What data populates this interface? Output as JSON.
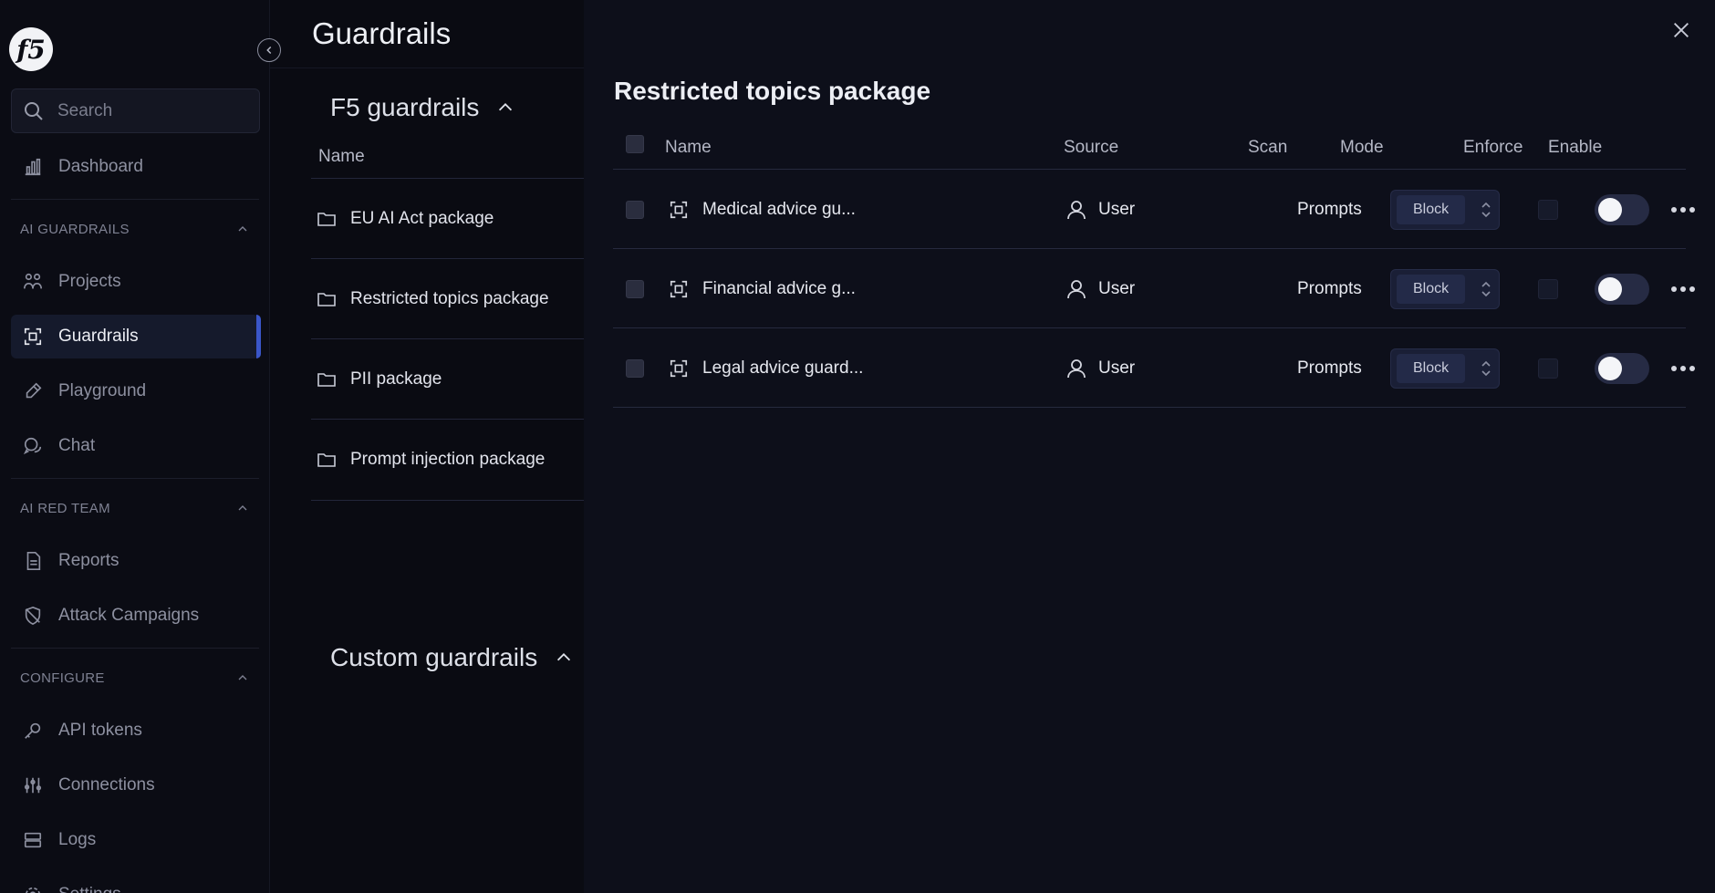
{
  "sidebar": {
    "logo": "f5",
    "search_placeholder": "Search",
    "dashboard": "Dashboard",
    "sections": {
      "ai_guardrails": "AI GUARDRAILS",
      "ai_red_team": "AI RED TEAM",
      "configure": "CONFIGURE"
    },
    "items": {
      "projects": "Projects",
      "guardrails": "Guardrails",
      "playground": "Playground",
      "chat": "Chat",
      "reports": "Reports",
      "attack_campaigns": "Attack Campaigns",
      "api_tokens": "API tokens",
      "connections": "Connections",
      "logs": "Logs",
      "settings": "Settings"
    }
  },
  "packages": {
    "page_title": "Guardrails",
    "f5_group": "F5 guardrails",
    "column_name": "Name",
    "items": [
      "EU AI Act package",
      "Restricted topics package",
      "PII package",
      "Prompt injection package"
    ],
    "custom_group": "Custom guardrails"
  },
  "main": {
    "title": "Restricted topics package",
    "columns": {
      "name": "Name",
      "source": "Source",
      "scan": "Scan",
      "mode": "Mode",
      "enforce": "Enforce",
      "enable": "Enable"
    },
    "rows": [
      {
        "name": "Medical advice gu...",
        "source": "User",
        "scan": "Prompts",
        "mode": "Block"
      },
      {
        "name": "Financial advice g...",
        "source": "User",
        "scan": "Prompts",
        "mode": "Block"
      },
      {
        "name": "Legal advice guard...",
        "source": "User",
        "scan": "Prompts",
        "mode": "Block"
      }
    ]
  },
  "colors": {
    "accent": "#3a56c9",
    "background": "#0a0b12",
    "panel": "#0d0f1a"
  }
}
